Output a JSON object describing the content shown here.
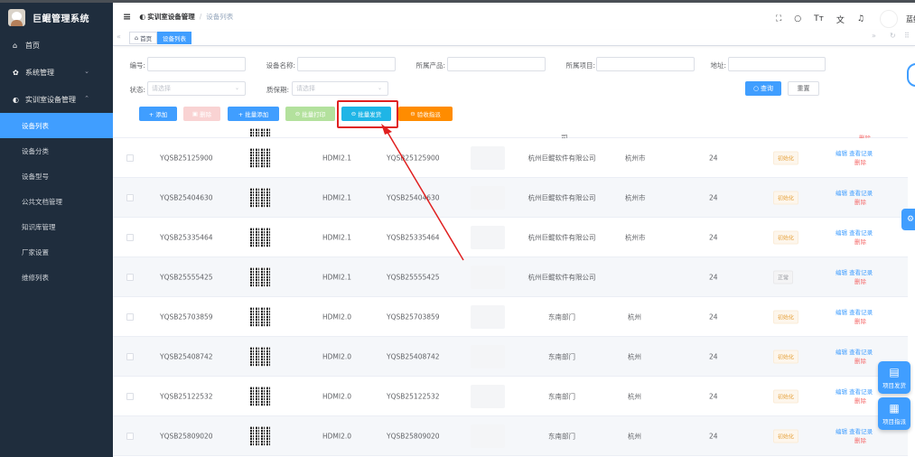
{
  "app": {
    "title": "巨鲲管理系统"
  },
  "sidebar": {
    "items": [
      {
        "label": "首页",
        "icon": "home-icon",
        "glyph": "⌂"
      },
      {
        "label": "系统管理",
        "icon": "gear-icon",
        "glyph": "✿",
        "arrow": "⌄"
      },
      {
        "label": "实训室设备管理",
        "icon": "device-icon",
        "glyph": "◐",
        "arrow": "⌃"
      }
    ],
    "subitems": [
      {
        "label": "设备列表",
        "active": true
      },
      {
        "label": "设备分类"
      },
      {
        "label": "设备型号"
      },
      {
        "label": "公共文档管理"
      },
      {
        "label": "知识库管理"
      },
      {
        "label": "厂家设置"
      },
      {
        "label": "维修列表"
      }
    ]
  },
  "navbar": {
    "breadcrumb_1": "实训室设备管理",
    "breadcrumb_sep": "/",
    "breadcrumb_2": "设备列表",
    "user_partial": "蓝鲲"
  },
  "tags": {
    "home": "首页",
    "current": "设备列表"
  },
  "search": {
    "code_label": "编号:",
    "name_label": "设备名称:",
    "product_label": "所属产品:",
    "project_label": "所属项目:",
    "address_label": "地址:",
    "status_label": "状态:",
    "status_placeholder": "请选择",
    "warranty_label": "质保期:",
    "warranty_placeholder": "请选择",
    "query_button": "查询",
    "reset_button": "重置"
  },
  "toolbar": {
    "add": "+ 添加",
    "delete": "删除",
    "batch_add": "+ 批量添加",
    "batch_print": "批量打印",
    "batch_ship": "批量发货",
    "accept": "验收指派"
  },
  "table": {
    "partial_top": {
      "cell_org_suffix": "司",
      "ops_delete": "删除"
    },
    "rows": [
      {
        "code": "YQSB25125900",
        "model": "HDMI2.1",
        "serial": "YQSB25125900",
        "org": "杭州巨鲲软件有限公司",
        "city": "杭州市",
        "months": "24",
        "status": "初始化"
      },
      {
        "code": "YQSB25404630",
        "model": "HDMI2.1",
        "serial": "YQSB25404630",
        "org": "杭州巨鲲软件有限公司",
        "city": "杭州市",
        "months": "24",
        "status": "初始化"
      },
      {
        "code": "YQSB25335464",
        "model": "HDMI2.1",
        "serial": "YQSB25335464",
        "org": "杭州巨鲲软件有限公司",
        "city": "杭州市",
        "months": "24",
        "status": "初始化"
      },
      {
        "code": "YQSB25555425",
        "model": "HDMI2.1",
        "serial": "YQSB25555425",
        "org": "杭州巨鲲软件有限公司",
        "city": "",
        "months": "24",
        "status": "正常"
      },
      {
        "code": "YQSB25703859",
        "model": "HDMI2.0",
        "serial": "YQSB25703859",
        "org": "东南部门",
        "city": "杭州",
        "months": "24",
        "status": "初始化"
      },
      {
        "code": "YQSB25408742",
        "model": "HDMI2.0",
        "serial": "YQSB25408742",
        "org": "东南部门",
        "city": "杭州",
        "months": "24",
        "status": "初始化"
      },
      {
        "code": "YQSB25122532",
        "model": "HDMI2.0",
        "serial": "YQSB25122532",
        "org": "东南部门",
        "city": "杭州",
        "months": "24",
        "status": "初始化"
      },
      {
        "code": "YQSB25809020",
        "model": "HDMI2.0",
        "serial": "YQSB25809020",
        "org": "东南部门",
        "city": "杭州",
        "months": "24",
        "status": "初始化"
      }
    ],
    "ops": {
      "edit": "编辑",
      "view": "查看记录",
      "delete": "删除"
    }
  },
  "floating": {
    "project_ship": "项目发货",
    "project_assign": "项目指派"
  },
  "colors": {
    "sidebar_bg": "#1f2d3d",
    "primary": "#409eff",
    "highlight": "#e02020",
    "ship_button": "#1fb5e6",
    "accept_button": "#ff8c00"
  }
}
